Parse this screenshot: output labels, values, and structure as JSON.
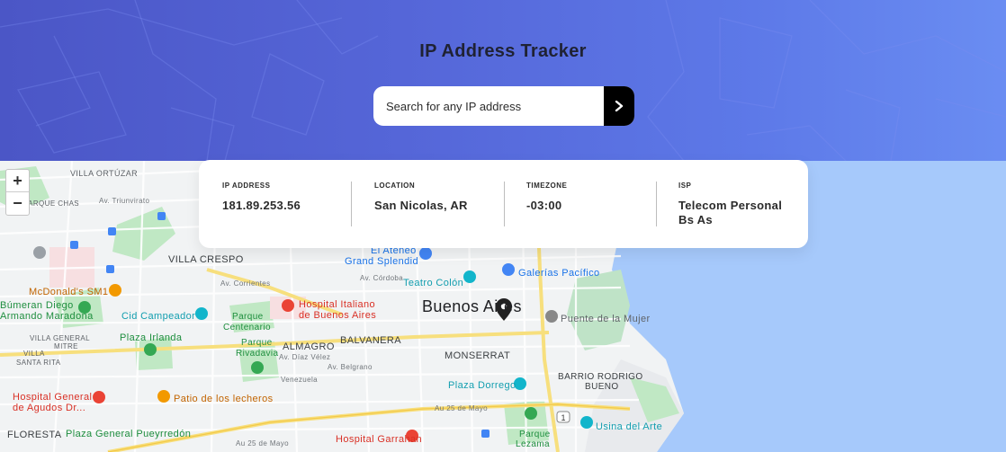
{
  "header": {
    "title": "IP Address Tracker",
    "search_placeholder": "Search for any IP address",
    "submit_icon": "chevron-right-icon"
  },
  "info": {
    "ip": {
      "label": "IP ADDRESS",
      "value": "181.89.253.56"
    },
    "location": {
      "label": "LOCATION",
      "value": "San Nicolas, AR"
    },
    "timezone": {
      "label": "TIMEZONE",
      "value": "-03:00"
    },
    "isp": {
      "label": "ISP",
      "value_line1": "Telecom Personal",
      "value_line2": "Bs As"
    }
  },
  "map": {
    "zoom_in": "+",
    "zoom_out": "−",
    "labels": {
      "villa_ortuzar": "VILLA ORTÚZAR",
      "parque_chas": "PARQUE CHAS",
      "av_triunvirato": "Av. Triunvirato",
      "villa_crespo": "VILLA CRESPO",
      "mcdonalds": "McDonald's SM1",
      "bumeran": "Búmeran Diego",
      "armando": "Armando Maradona",
      "cid": "Cid Campeador",
      "parque_centenario_1": "Parque",
      "parque_centenario_2": "Centenario",
      "hospital_italiano_1": "Hospital Italiano",
      "hospital_italiano_2": "de Buenos Aires",
      "buenos_aires": "Buenos Aires",
      "el_ateneo_1": "El Ateneo",
      "el_ateneo_2": "Grand Splendid",
      "teatro_colon": "Teatro Colón",
      "galerias": "Galerías Pacífico",
      "puente": "Puente de la Mujer",
      "villa_general_mitre_1": "VILLA GENERAL",
      "villa_general_mitre_2": "MITRE",
      "villa_santa_rita_1": "VILLA",
      "villa_santa_rita_2": "SANTA RITA",
      "plaza_irlanda": "Plaza Irlanda",
      "parque_rivadavia_1": "Parque",
      "parque_rivadavia_2": "Rivadavia",
      "almagro": "ALMAGRO",
      "balvanera": "BALVANERA",
      "monserrat": "MONSERRAT",
      "barrio_rodrigo_1": "BARRIO RODRIGO",
      "barrio_rodrigo_2": "BUENO",
      "plaza_dorrego": "Plaza Dorrego",
      "hospital_general_1": "Hospital General",
      "hospital_general_2": "de Agudos Dr...",
      "patio": "Patio de los lecheros",
      "floresta": "FLORESTA",
      "plaza_pueyrredon": "Plaza General Pueyrredón",
      "hospital_garrahan": "Hospital Garrahan",
      "parque_lezama_1": "Parque",
      "parque_lezama_2": "Lezama",
      "usina": "Usina del Arte",
      "av_25_mayo_1": "Au 25 de Mayo",
      "av_25_mayo_2": "Au 25 de Mayo",
      "av_belgrano": "Av. Belgrano",
      "av_diaz_velez": "Av. Díaz Vélez",
      "av_cordoba": "Av. Córdoba",
      "av_corrientes": "Av. Corrientes",
      "venezuela": "Venezuela",
      "route_1": "1"
    }
  },
  "colors": {
    "header_start": "#4b56c6",
    "header_end": "#6a8df2",
    "water": "#a6c9fb",
    "park": "#c0e8c4",
    "road_major": "#f7df7d",
    "pin": "#222222"
  }
}
